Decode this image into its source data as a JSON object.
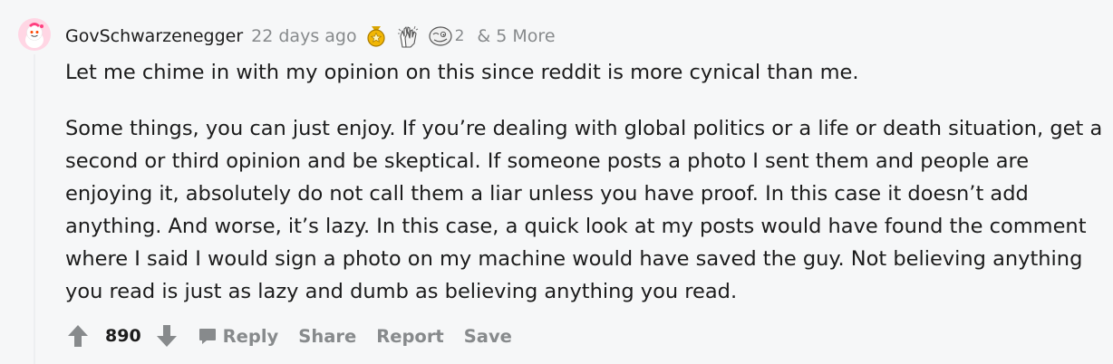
{
  "comment": {
    "author": "GovSchwarzenegger",
    "timestamp": "22 days ago",
    "awards": [
      {
        "icon": "gold-medal-award-icon"
      },
      {
        "icon": "clapping-hands-award-icon"
      },
      {
        "icon": "face-award-icon",
        "count": "2"
      }
    ],
    "more_awards": "& 5 More",
    "body_paragraphs": [
      "Let me chime in with my opinion on this since reddit is more cynical than me.",
      "Some things, you can just enjoy. If you’re dealing with global politics or a life or death situation, get a second or third opinion and be skeptical. If someone posts a photo I sent them and people are enjoying it, absolutely do not call them a liar unless you have proof. In this case it doesn’t add anything. And worse, it’s lazy. In this case, a quick look at my posts would have found the comment where I said I would sign a photo on my machine would have saved the guy. Not believing anything you read is just as lazy and dumb as believing anything you read."
    ],
    "score": "890",
    "actions": {
      "reply": "Reply",
      "share": "Share",
      "report": "Report",
      "save": "Save"
    }
  },
  "colors": {
    "background": "#f6f7f8",
    "text": "#1c1c1c",
    "muted": "#878a8c",
    "avatar_bg": "#ffe3ec",
    "gold": "#f2b705"
  }
}
